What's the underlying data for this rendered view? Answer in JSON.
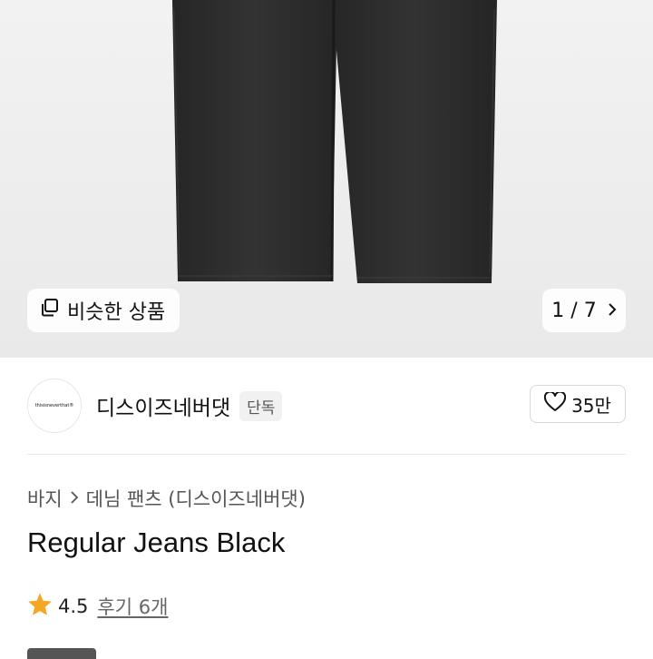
{
  "gallery": {
    "similar_label": "비슷한 상품",
    "pager_label": "1 / 7"
  },
  "brand": {
    "logo_text": "thisisneverthat®",
    "name": "디스이즈네버댓",
    "badge": "단독",
    "like_count": "35만"
  },
  "breadcrumb": {
    "category": "바지",
    "subcategory": "데님 팬츠 (디스이즈네버댓)"
  },
  "product": {
    "title": "Regular Jeans Black",
    "rating": "4.5",
    "reviews": "후기 6개"
  },
  "colors": {
    "star": "#f5a623",
    "denim": "#2b2b2b"
  }
}
